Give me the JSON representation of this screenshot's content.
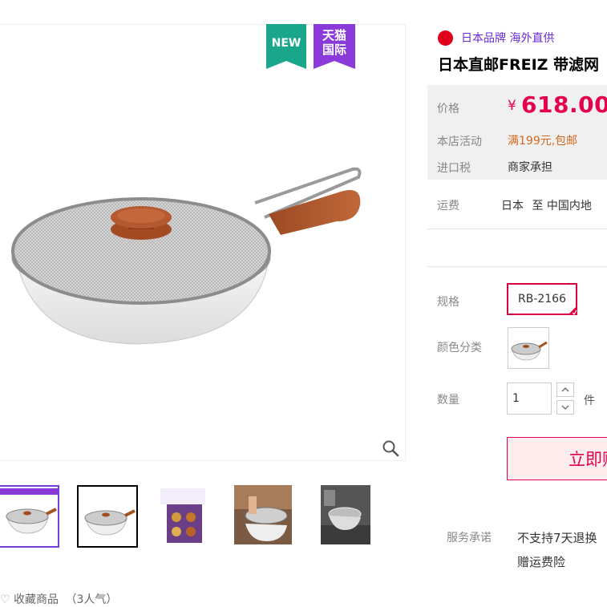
{
  "gallery": {
    "badge_new": "NEW",
    "badge_tmall_line1": "天猫",
    "badge_tmall_line2": "国际",
    "favorite_text": "收藏商品",
    "favorite_count": "（3人气）"
  },
  "product": {
    "brand_tag": "日本品牌 海外直供",
    "title": "日本直邮FREIZ 带滤网",
    "price_label": "价格",
    "price_symbol": "¥",
    "price": "618.00",
    "promo_label": "本店活动",
    "promo_value": "满199元,包邮",
    "tax_label": "进口税",
    "tax_value": "商家承担",
    "shipping_label": "运费",
    "shipping_from": "日本",
    "shipping_to": "至 中国内地",
    "spec_label": "规格",
    "spec_value": "RB-2166",
    "color_label": "颜色分类",
    "qty_label": "数量",
    "qty_value": "1",
    "qty_unit": "件",
    "buy_label": "立即购",
    "service_label": "服务承诺",
    "service_line1": "不支持7天退换",
    "service_line2": "赠运费险"
  },
  "colors": {
    "accent": "#e5004f",
    "brand_purple": "#6a2bd9",
    "new_badge": "#1aa68a",
    "tmall_badge": "#8a3ad8"
  }
}
